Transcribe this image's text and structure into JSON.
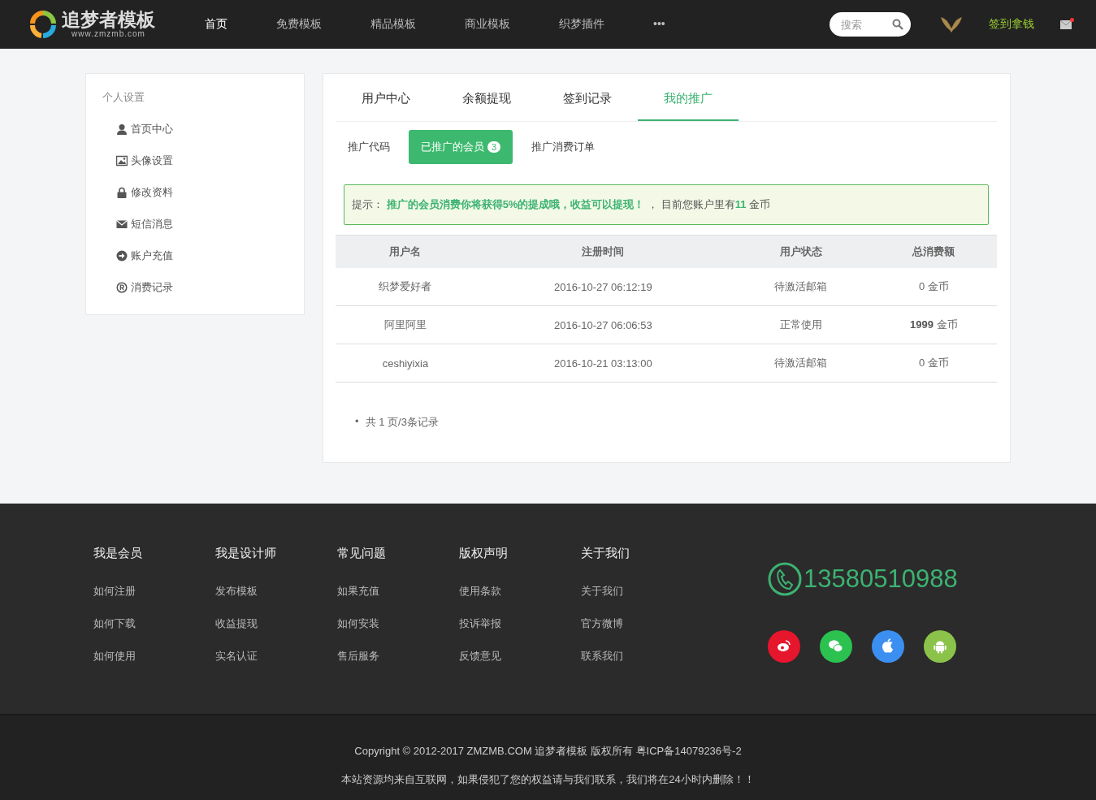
{
  "header": {
    "logo": {
      "name": "追梦者模板",
      "url": "www.zmzmb.com"
    },
    "nav": [
      {
        "label": "首页",
        "selected": true
      },
      {
        "label": "免费模板",
        "selected": false
      },
      {
        "label": "精品模板",
        "selected": false
      },
      {
        "label": "商业模板",
        "selected": false
      },
      {
        "label": "织梦插件",
        "selected": false
      },
      {
        "label": "•••",
        "selected": false
      }
    ],
    "search": {
      "placeholder": "搜索"
    },
    "signin": "签到拿钱",
    "mail": {
      "unread": true
    }
  },
  "sidebar": {
    "title": "个人设置",
    "items": [
      {
        "kind": "user",
        "label": "首页中心"
      },
      {
        "kind": "image",
        "label": "头像设置"
      },
      {
        "kind": "lock",
        "label": "修改资料"
      },
      {
        "kind": "envelope",
        "label": "短信消息"
      },
      {
        "kind": "arrow",
        "label": "账户充值"
      },
      {
        "kind": "registered",
        "label": "消费记录"
      }
    ]
  },
  "tabs": [
    {
      "label": "用户中心",
      "selected": false
    },
    {
      "label": "余额提现",
      "selected": false
    },
    {
      "label": "签到记录",
      "selected": false
    },
    {
      "label": "我的推广",
      "selected": true
    }
  ],
  "subtabs": [
    {
      "label": "推广代码",
      "selected": false
    },
    {
      "label": "已推广的会员",
      "badge": "3",
      "selected": true
    },
    {
      "label": "推广消费订单",
      "selected": false
    }
  ],
  "notice": "提示： **推广的会员消费你将获得5%的提成哦，收益可以提现！** ， 目前您账户里有**11** 金币",
  "table": {
    "columns": [
      "用户名",
      "注册时间",
      "用户状态",
      "总消费额"
    ],
    "rows": [
      [
        "织梦爱好者",
        "2016-10-27 06:12:19",
        "待激活邮箱",
        "0 金币"
      ],
      [
        "阿里阿里",
        "2016-10-27 06:06:53",
        "正常使用",
        "**1999** 金币"
      ],
      [
        "ceshiyixia",
        "2016-10-21 03:13:00",
        "待激活邮箱",
        "0 金币"
      ]
    ]
  },
  "pager": {
    "bullet": "•",
    "text": "共 1 页/3条记录"
  },
  "footer": {
    "columns": [
      {
        "heading": "我是会员",
        "links": [
          "如何注册",
          "如何下载",
          "如何使用"
        ]
      },
      {
        "heading": "我是设计师",
        "links": [
          "发布模板",
          "收益提现",
          "实名认证"
        ]
      },
      {
        "heading": "常见问题",
        "links": [
          "如果充值",
          "如何安装",
          "售后服务"
        ]
      },
      {
        "heading": "版权声明",
        "links": [
          "使用条款",
          "投诉举报",
          "反馈意见"
        ]
      },
      {
        "heading": "关于我们",
        "links": [
          "关于我们",
          "官方微博",
          "联系我们"
        ]
      }
    ],
    "phone": "13580510988",
    "social": [
      {
        "kind": "weibo",
        "color": "#e6162d"
      },
      {
        "kind": "wechat",
        "color": "#2bc24f"
      },
      {
        "kind": "apple",
        "color": "#3b8ff0"
      },
      {
        "kind": "android",
        "color": "#8bc34a"
      }
    ],
    "copyright": "Copyright © 2012-2017 ZMZMB.COM 追梦者模板 版权所有 粤ICP备14079236号-2",
    "disclaimer": "本站资源均来自互联网，如果侵犯了您的权益请与我们联系，我们将在24小时内删除！！"
  }
}
